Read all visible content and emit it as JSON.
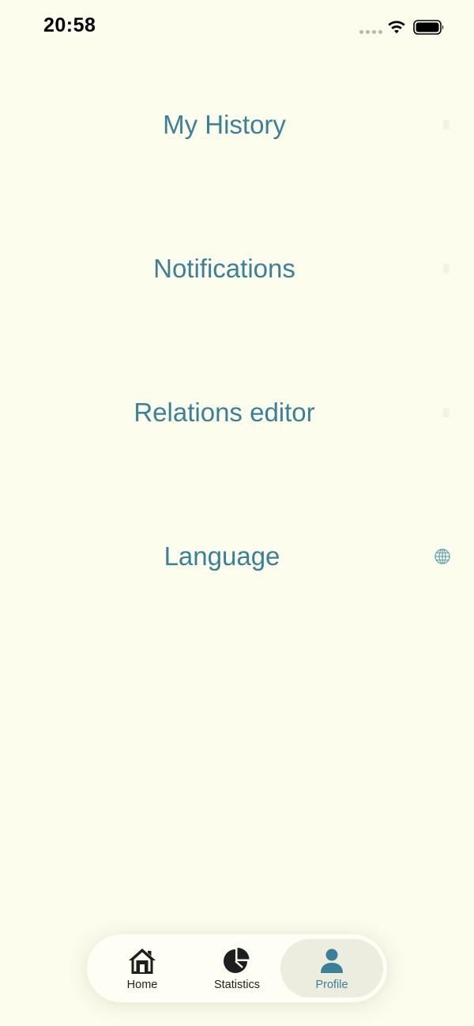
{
  "status_bar": {
    "time": "20:58",
    "icons": [
      "signal-dots-icon",
      "wifi-icon",
      "battery-icon"
    ]
  },
  "menu": {
    "items": [
      {
        "label": "My History",
        "icon": "chevron-right-icon"
      },
      {
        "label": "Notifications",
        "icon": "chevron-right-icon"
      },
      {
        "label": "Relations editor",
        "icon": "chevron-right-icon"
      },
      {
        "label": "Language",
        "icon": "globe-icon"
      }
    ]
  },
  "bottom_nav": {
    "tabs": [
      {
        "label": "Home",
        "icon": "home-icon",
        "active": false
      },
      {
        "label": "Statistics",
        "icon": "pie-chart-icon",
        "active": false
      },
      {
        "label": "Profile",
        "icon": "person-icon",
        "active": true
      }
    ]
  },
  "colors": {
    "background": "#FDFDEE",
    "accent": "#3A8096",
    "active_tab_bg": "#ECECDF",
    "text_dark": "#1E1E1E"
  }
}
